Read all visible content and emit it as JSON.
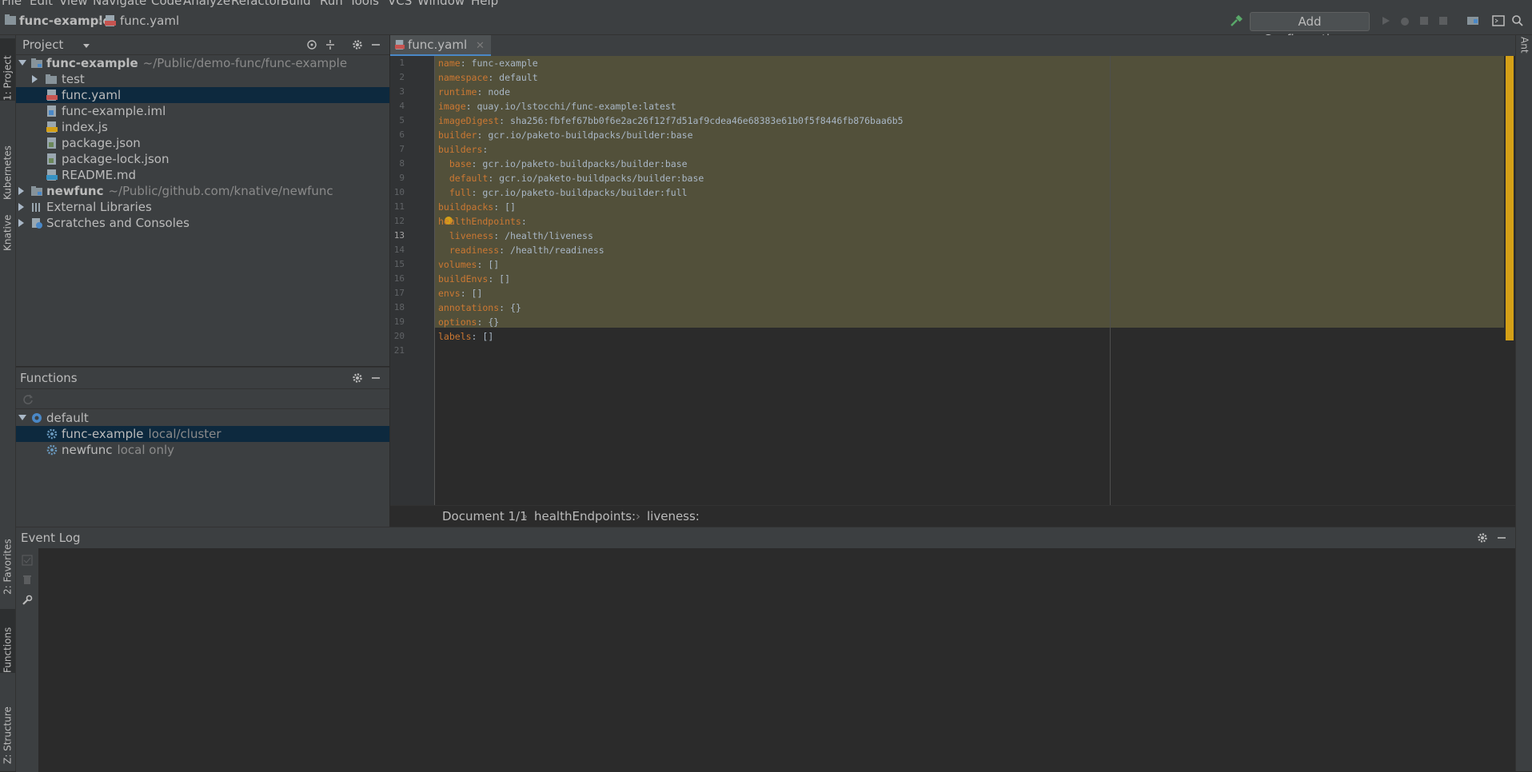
{
  "menu": [
    "File",
    "Edit",
    "View",
    "Navigate",
    "Code",
    "Analyze",
    "Refactor",
    "Build",
    "Run",
    "Tools",
    "VCS",
    "Window",
    "Help"
  ],
  "navbar": {
    "project": "func-example",
    "file": "func.yaml",
    "add_config": "Add Configuration..."
  },
  "left_tabs": [
    "1: Project",
    "Kubernetes",
    "Knative",
    "2: Favorites",
    "Functions",
    "Z: Structure"
  ],
  "right_tabs": [
    "Ant"
  ],
  "project_panel": {
    "title": "Project",
    "root": {
      "name": "func-example",
      "path": "~/Public/demo-func/func-example"
    },
    "children": [
      "test",
      "func.yaml",
      "func-example.iml",
      "index.js",
      "package.json",
      "package-lock.json",
      "README.md"
    ],
    "other_roots": [
      {
        "name": "newfunc",
        "path": "~/Public/github.com/knative/newfunc"
      },
      {
        "name": "External Libraries",
        "path": ""
      },
      {
        "name": "Scratches and Consoles",
        "path": ""
      }
    ]
  },
  "functions_panel": {
    "title": "Functions",
    "namespace": "default",
    "items": [
      {
        "name": "func-example",
        "hint": "local/cluster"
      },
      {
        "name": "newfunc",
        "hint": "local only"
      }
    ]
  },
  "editor": {
    "tab": "func.yaml",
    "current_line": 13,
    "lines": [
      [
        "name",
        ": func-example"
      ],
      [
        "namespace",
        ": default"
      ],
      [
        "runtime",
        ": node"
      ],
      [
        "image",
        ": quay.io/lstocchi/func-example:latest"
      ],
      [
        "imageDigest",
        ": sha256:fbfef67bb0f6e2ac26f12f7d51af9cdea46e68383e61b0f5f8446fb876baa6b5"
      ],
      [
        "builder",
        ": gcr.io/paketo-buildpacks/builder:base"
      ],
      [
        "builders",
        ":"
      ],
      [
        "  base",
        ": gcr.io/paketo-buildpacks/builder:base"
      ],
      [
        "  default",
        ": gcr.io/paketo-buildpacks/builder:base"
      ],
      [
        "  full",
        ": gcr.io/paketo-buildpacks/builder:full"
      ],
      [
        "buildpacks",
        ": []"
      ],
      [
        "healthEndpoints",
        ":"
      ],
      [
        "  liveness",
        ": /health/liveness"
      ],
      [
        "  readiness",
        ": /health/readiness"
      ],
      [
        "volumes",
        ": []"
      ],
      [
        "buildEnvs",
        ": []"
      ],
      [
        "envs",
        ": []"
      ],
      [
        "annotations",
        ": {}"
      ],
      [
        "options",
        ": {}"
      ],
      [
        "labels",
        ": []"
      ],
      [
        "",
        ""
      ]
    ],
    "breadcrumbs": [
      "Document 1/1",
      "healthEndpoints:",
      "liveness:"
    ]
  },
  "event_log": {
    "title": "Event Log"
  },
  "colors": {
    "accent": "#4a88c7",
    "key": "#cc7832",
    "highlight": "#52503a",
    "selection": "#0d293e",
    "marker": "#d4a017"
  }
}
